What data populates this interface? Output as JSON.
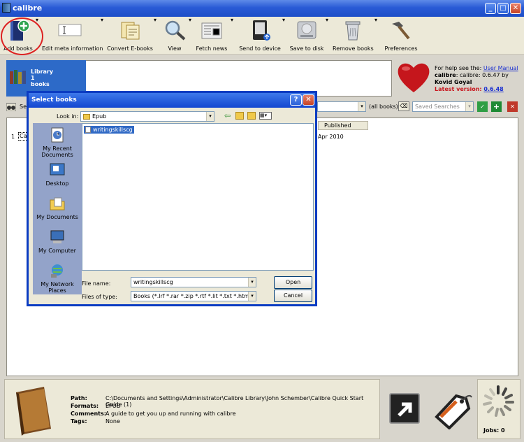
{
  "window": {
    "title": "calibre",
    "min": "_",
    "max": "□",
    "close": "✕"
  },
  "toolbar": {
    "add_books": "Add books",
    "edit_meta": "Edit meta information",
    "convert": "Convert E-books",
    "view": "View",
    "fetch_news": "Fetch news",
    "send_device": "Send to device",
    "save_disk": "Save to disk",
    "remove": "Remove books",
    "preferences": "Preferences"
  },
  "library": {
    "line1": "Library",
    "line2": "1",
    "line3": "books"
  },
  "help": {
    "prefix": "For help see the: ",
    "manual": "User Manual",
    "version_prefix": "calibre: 0.6.47 by ",
    "author": "Kovid Goyal",
    "latest_label": "Latest version: ",
    "latest": "0.6.48"
  },
  "search": {
    "label": "Se",
    "all_books": "(all books)",
    "saved_searches": "Saved Searches"
  },
  "table": {
    "col_published": "Published",
    "row_num": "1",
    "row_title": "Ca",
    "row_published": "Apr 2010"
  },
  "details": {
    "path_label": "Path:",
    "path": "C:\\Documents and Settings\\Administrator\\Calibre Library\\John Schember\\Calibre Quick Start Guide (1)",
    "formats_label": "Formats:",
    "formats": "EPUB",
    "comments_label": "Comments:",
    "comments": "A guide to get you up and running with calibre",
    "tags_label": "Tags:",
    "tags": "None"
  },
  "jobs": "Jobs: 0",
  "dialog": {
    "title": "Select books",
    "look_in_label": "Look in:",
    "look_in": "Epub",
    "places": [
      "My Recent Documents",
      "Desktop",
      "My Documents",
      "My Computer",
      "My Network Places"
    ],
    "file": "writingskillscg",
    "file_name_label": "File name:",
    "file_name": "writingskillscg",
    "file_type_label": "Files of type:",
    "file_type": "Books (*.lrf *.rar *.zip *.rtf *.lit *.txt *.htm *.xhtm *.",
    "open": "Open",
    "cancel": "Cancel",
    "help_btn": "?",
    "close_btn": "✕"
  },
  "colors": {
    "selection": "#2d6ac8",
    "title_bar": "#2a5bd6",
    "latest_red": "#c8161e"
  }
}
